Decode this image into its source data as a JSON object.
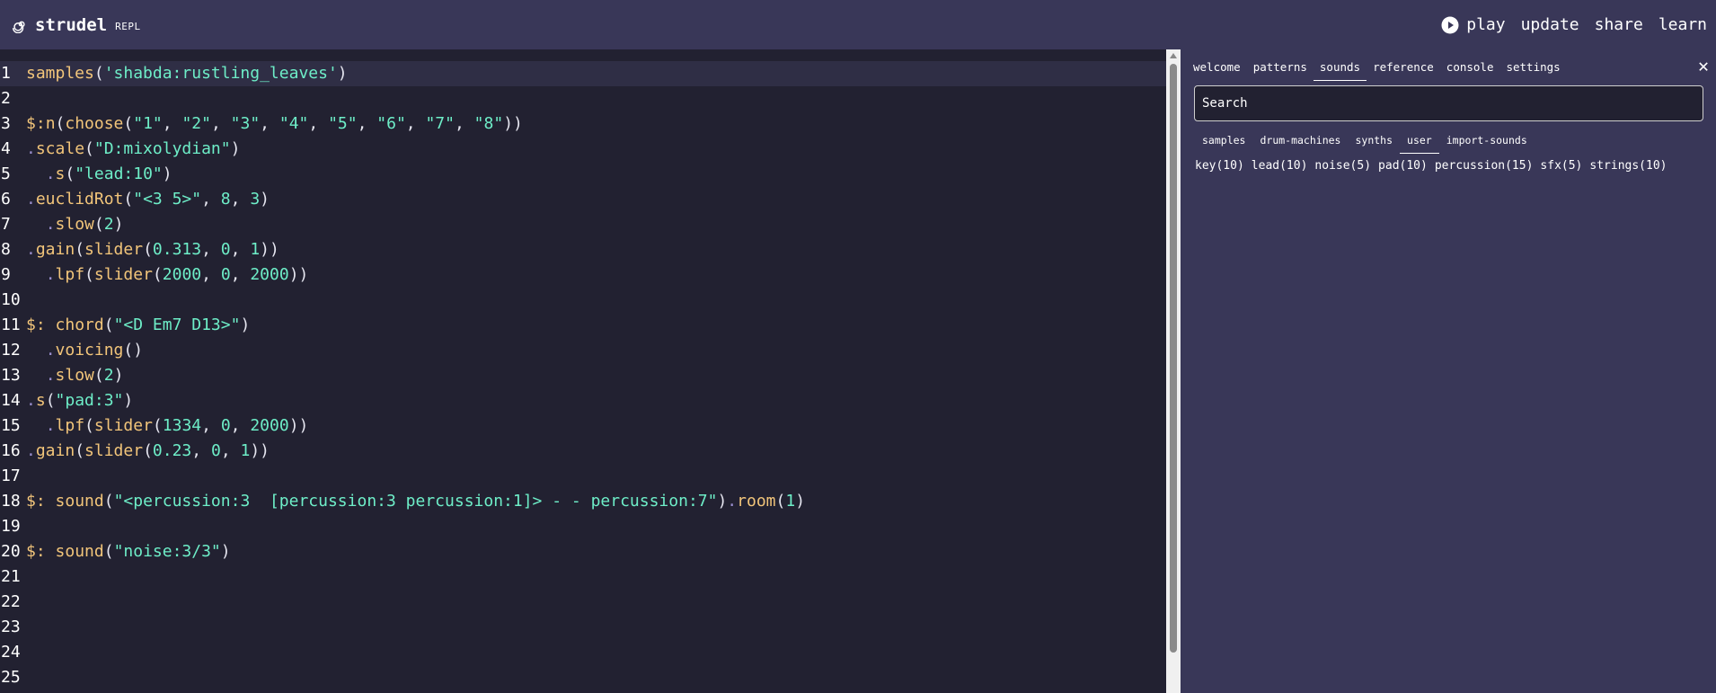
{
  "header": {
    "title": "strudel",
    "subtitle": "REPL",
    "nav": {
      "play": "play",
      "update": "update",
      "share": "share",
      "learn": "learn"
    }
  },
  "editor": {
    "line_numbers": [
      "1",
      "2",
      "3",
      "4",
      "5",
      "6",
      "7",
      "8",
      "9",
      "10",
      "11",
      "12",
      "13",
      "14",
      "15",
      "16",
      "17",
      "18",
      "19",
      "20",
      "21",
      "22",
      "23",
      "24",
      "25"
    ],
    "lines": [
      "samples('shabda:rustling_leaves')",
      "",
      "$:n(choose(\"1\", \"2\", \"3\", \"4\", \"5\", \"6\", \"7\", \"8\"))",
      ".scale(\"D:mixolydian\")",
      "  .s(\"lead:10\")",
      ".euclidRot(\"<3 5>\", 8, 3)",
      "  .slow(2)",
      ".gain(slider(0.313, 0, 1))",
      "  .lpf(slider(2000, 0, 2000))",
      "",
      "$: chord(\"<D Em7 D13>\")",
      "  .voicing()",
      "  .slow(2)",
      ".s(\"pad:3\")",
      "  .lpf(slider(1334, 0, 2000))",
      ".gain(slider(0.23, 0, 1))",
      "",
      "$: sound(\"<percussion:3  [percussion:3 percussion:1]> - - percussion:7\").room(1)",
      "",
      "$: sound(\"noise:3/3\")",
      "",
      "",
      "",
      "",
      ""
    ]
  },
  "panel": {
    "tabs": [
      "welcome",
      "patterns",
      "sounds",
      "reference",
      "console",
      "settings"
    ],
    "active_tab": "sounds",
    "close": "✕",
    "search_placeholder": "Search",
    "subtabs": [
      "samples",
      "drum-machines",
      "synths",
      "user",
      "import-sounds"
    ],
    "active_subtab": "user",
    "sounds": [
      "key(10)",
      "lead(10)",
      "noise(5)",
      "pad(10)",
      "percussion(15)",
      "sfx(5)",
      "strings(10)"
    ]
  },
  "icons": {
    "logo": "spiral-icon",
    "play": "play-circle-icon",
    "close": "close-icon"
  },
  "colors": {
    "header_bg": "#393758",
    "editor_bg": "#222131",
    "panel_bg": "#393758",
    "function": "#f2c57a",
    "string": "#6eeec8",
    "operator": "#9a8fd0"
  }
}
